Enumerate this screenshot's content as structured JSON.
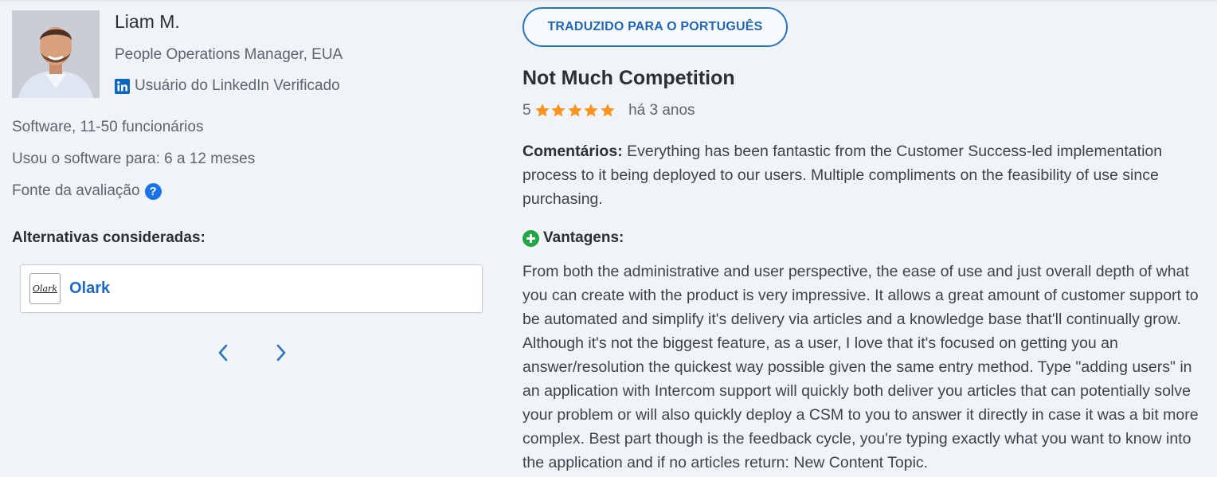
{
  "reviewer": {
    "name": "Liam M.",
    "role": "People Operations Manager, EUA",
    "verification": "Usuário do LinkedIn Verificado",
    "company_info": "Software, 11-50 funcionários",
    "usage_duration": "Usou o software para: 6 a 12 meses",
    "review_source_label": "Fonte da avaliação",
    "help_icon_glyph": "?"
  },
  "alternatives": {
    "heading": "Alternativas consideradas:",
    "items": [
      {
        "name": "Olark",
        "logo_text": "Olark"
      }
    ]
  },
  "review": {
    "translate_button": "TRADUZIDO PARA O PORTUGUÊS",
    "title": "Not Much Competition",
    "rating": 5,
    "max_rating": 5,
    "time_ago": "há 3 anos",
    "comments_label": "Comentários:",
    "comments_text": " Everything has been fantastic from the Customer Success-led implementation process to it being deployed to our users. Multiple compliments on the feasibility of use since purchasing.",
    "pros_label": "Vantagens:",
    "pros_text": "From both the administrative and user perspective, the ease of use and just overall depth of what you can create with the product is very impressive. It allows a great amount of customer support to be automated and simplify it's delivery via articles and a knowledge base that'll continually grow. Although it's not the biggest feature, as a user, I love that it's focused on getting you an answer/resolution the quickest way possible given the same entry method. Type \"adding users\" in an application with Intercom support will quickly both deliver you articles that can potentially solve your problem or will also quickly deploy a CSM to you to answer it directly in case it was a bit more complex. Best part though is the feedback cycle, you're typing exactly what you want to know into the application and if no articles return: New Content Topic."
  },
  "colors": {
    "star": "#f7931e",
    "link": "#1b6ac9",
    "linkedin": "#0a66c2",
    "pros_icon": "#20a645",
    "background": "#f1f4f7"
  }
}
